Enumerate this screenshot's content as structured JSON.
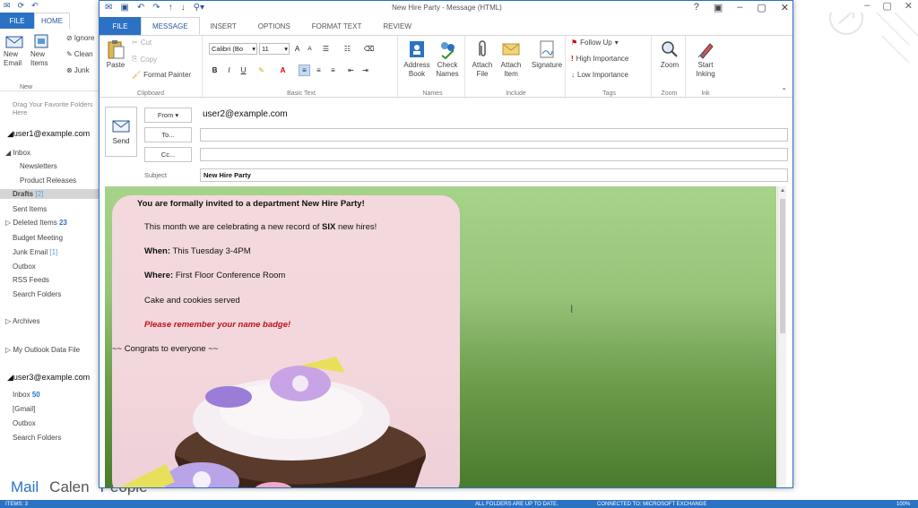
{
  "background": {
    "tabs": [
      {
        "label": "FILE"
      },
      {
        "label": "HOME"
      }
    ],
    "ribbon": {
      "new_email": "New Email",
      "new_items": "New Items",
      "ignore": "Ignore",
      "clean_up": "Clean",
      "junk": "Junk",
      "group_new": "New"
    },
    "folder_pane": {
      "drag_hint": "Drag Your Favorite Folders Here",
      "account1": "user1@example.com",
      "inbox": "Inbox",
      "newsletters": "Newsletters",
      "product_releases": "Product Releases",
      "drafts": "Drafts",
      "drafts_count": "[2]",
      "sent_items": "Sent Items",
      "deleted_items": "Deleted Items",
      "deleted_count": "23",
      "budget_meeting": "Budget Meeting",
      "junk_email": "Junk Email",
      "junk_count": "[1]",
      "outbox": "Outbox",
      "rss_feeds": "RSS Feeds",
      "search_folders": "Search Folders",
      "archives": "Archives",
      "my_outlook_data_file": "My Outlook Data File",
      "account2": "user3@example.com",
      "inbox2": "Inbox",
      "inbox2_count": "50",
      "gmail": "[Gmail]",
      "outbox2": "Outbox",
      "search_folders2": "Search Folders"
    },
    "bottom_nav": {
      "mail": "Mail",
      "calendar": "Calen",
      "people": "People"
    },
    "status": {
      "items": "ITEMS: 3",
      "sync": "ALL FOLDERS ARE UP TO DATE.",
      "conn": "CONNECTED TO: MICROSOFT EXCHANGE",
      "zoom": "100%"
    }
  },
  "message_window": {
    "caption": "New Hire Party - Message (HTML)",
    "window_controls": [
      "?",
      "▣",
      "–",
      "▢",
      "✕"
    ],
    "tabs": [
      {
        "label": "FILE"
      },
      {
        "label": "MESSAGE"
      },
      {
        "label": "INSERT"
      },
      {
        "label": "OPTIONS"
      },
      {
        "label": "FORMAT TEXT"
      },
      {
        "label": "REVIEW"
      }
    ],
    "ribbon": {
      "clipboard": {
        "paste": "Paste",
        "cut": "Cut",
        "copy": "Copy",
        "format_painter": "Format Painter",
        "label": "Clipboard"
      },
      "basic_text": {
        "font": "Calibri (Bo",
        "size": "11",
        "label": "Basic Text"
      },
      "names": {
        "address_book": "Address Book",
        "check_names": "Check Names",
        "label": "Names"
      },
      "include": {
        "attach_file": "Attach File",
        "attach_item": "Attach Item",
        "signature": "Signature",
        "label": "Include"
      },
      "tags": {
        "follow_up": "Follow Up",
        "high_importance": "High Importance",
        "low_importance": "Low Importance",
        "label": "Tags"
      },
      "zoom": {
        "zoom": "Zoom",
        "label": "Zoom"
      },
      "ink": {
        "start_inking": "Start Inking",
        "label": "Ink"
      }
    },
    "header": {
      "send": "Send",
      "from_button": "From",
      "from_value": "user2@example.com",
      "to_button": "To...",
      "to_value": "",
      "cc_button": "Cc...",
      "cc_value": "",
      "subject_label": "Subject",
      "subject_value": "New Hire Party"
    },
    "body": {
      "heading": "You are formally invited to a department New Hire Party!",
      "line1_pre": "This month we are celebrating a new record of ",
      "line1_bold": "SIX",
      "line1_post": " new hires!",
      "when_label": "When:",
      "when_value": " This Tuesday 3-4PM",
      "where_label": "Where:",
      "where_value": "  First Floor Conference Room",
      "cake": "Cake and cookies served",
      "reminder": "Please remember your name badge!",
      "congrats": "~~ Congrats to everyone  ~~"
    }
  }
}
